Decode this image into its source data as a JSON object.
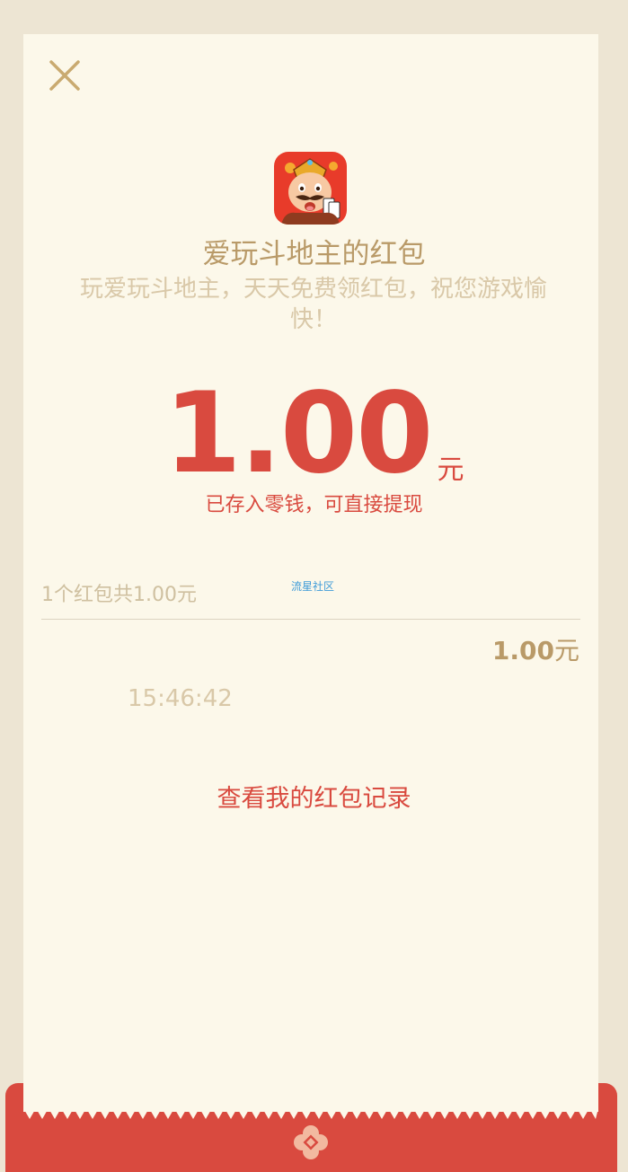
{
  "header": {
    "close_icon": "close-icon"
  },
  "app": {
    "icon": "app-icon-landlord-character",
    "title": "爱玩斗地主的红包",
    "subtitle": "玩爱玩斗地主，天天免费领红包，祝您游戏愉快！"
  },
  "amount": {
    "value": "1.00",
    "unit": "元",
    "note": "已存入零钱，可直接提现"
  },
  "summary": {
    "text": "1个红包共1.00元",
    "watermark": "流星社区"
  },
  "record": {
    "amount": "1.00",
    "unit": "元",
    "time": "15:46:42"
  },
  "link": {
    "label": "查看我的红包记录"
  },
  "colors": {
    "accent_red": "#D94A3F",
    "gold_text": "#B99A68",
    "pale_text": "#D9C8A8",
    "card_bg": "#FCF8EA",
    "page_bg": "#EDE5D3"
  }
}
